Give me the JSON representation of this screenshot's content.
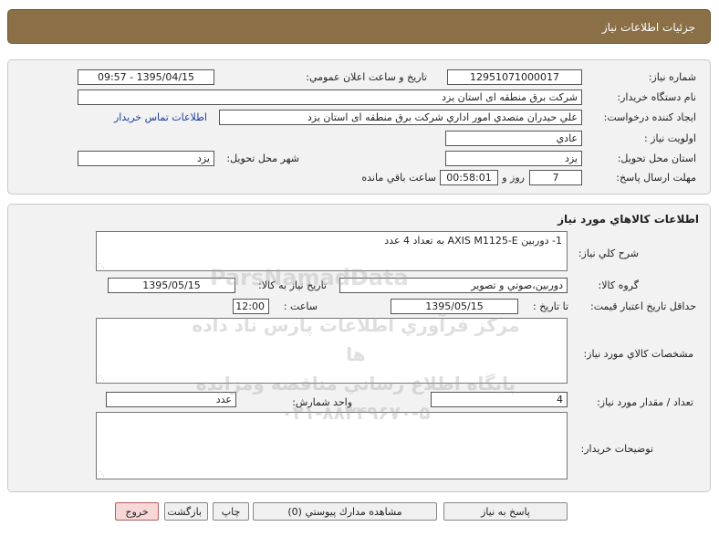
{
  "header": {
    "title": "جزئيات اطلاعات نياز"
  },
  "need_info": {
    "need_number_label": "شماره نياز:",
    "need_number": "12951071000017",
    "announce_label": "تاريخ و ساعت اعلان عمومي:",
    "announce_value": "1395/04/15 - 09:57",
    "buyer_org_label": "نام دستگاه خريدار:",
    "buyer_org": "شركت برق منطقه اى استان يزد",
    "requester_label": "ايجاد كننده درخواست:",
    "requester": "علي حيدران متصدي امور اداري شركت برق منطقه اى استان يزد",
    "contact_link": "اطلاعات تماس خريدار",
    "priority_label": "اولويت نياز :",
    "priority": "عادي",
    "province_label": "استان محل تحويل:",
    "province": "يزد",
    "city_label": "شهر محل تحويل:",
    "city": "يزد",
    "deadline_label": "مهلت ارسال پاسخ:",
    "days": "7",
    "days_unit": "روز و",
    "time_left": "00:58:01",
    "time_left_label": "ساعت باقي مانده"
  },
  "goods": {
    "section_title": "اطلاعات كالاهاي مورد نياز",
    "desc_label": "شرح كلي نياز:",
    "desc": "1- دوربين AXIS M1125-E به تعداد 4 عدد",
    "group_label": "گروه كالا:",
    "group": "دوربين،صوتي و تصوير",
    "need_date_label": "تاريخ نياز به كالا:",
    "need_date": "1395/05/15",
    "min_validity_label": "حداقل تاريخ اعتبار قيمت:",
    "until_label": "تا تاريخ :",
    "until_date": "1395/05/15",
    "hour_label": "ساعت :",
    "hour": "12:00",
    "specs_label": "مشخصات كالاي مورد نياز:",
    "qty_label": "تعداد / مقدار مورد نياز:",
    "qty": "4",
    "unit_label": "واحد شمارش:",
    "unit": "عدد",
    "buyer_notes_label": "توضيحات خريدار:"
  },
  "buttons": {
    "reply": "پاسخ به نياز",
    "attachments": "مشاهده مدارك پيوستي (0)",
    "print": "چاپ",
    "back": "بازگشت",
    "exit": "خروج"
  },
  "watermark": {
    "line1": "مركز فرآوري اطلاعات پارس ناد داده ها",
    "line2": "پايگاه اطلاع رساني مناقصه ومزايده",
    "line3": "۰۲۱-۸۸۳۴۹۶۷۰-۵",
    "brand": "ParsNamadData"
  },
  "colors": {
    "header_bg": "#8b6f47",
    "link": "#1a3d9e",
    "exit_btn": "#f7d7d7"
  }
}
